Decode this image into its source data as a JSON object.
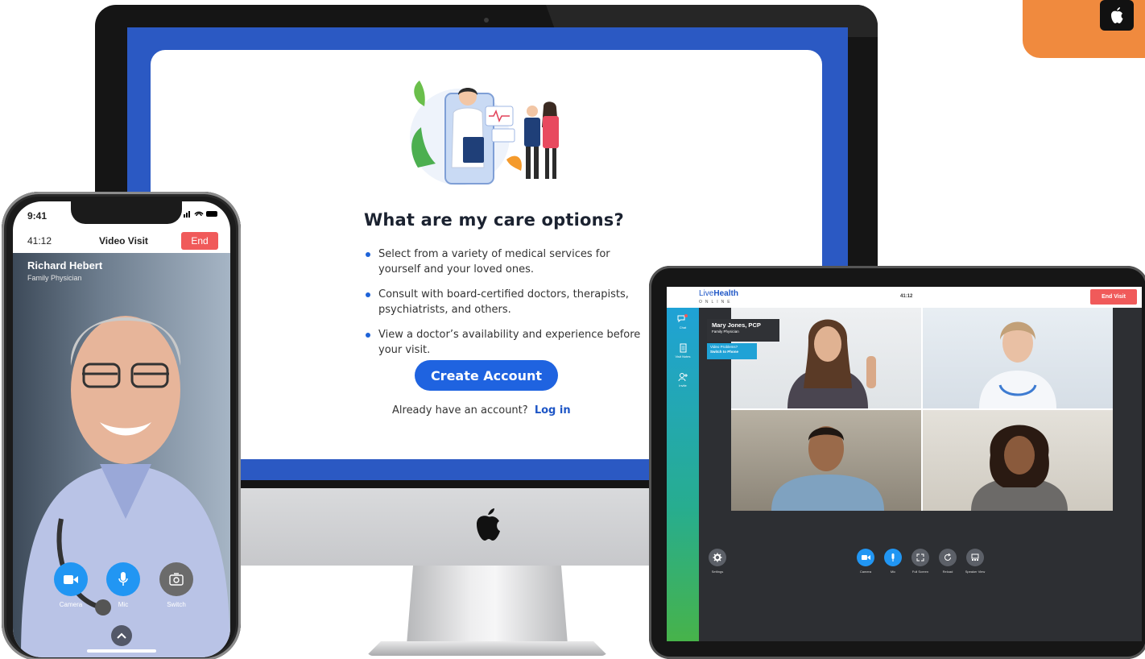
{
  "imac": {
    "title": "What are my care options?",
    "bullets": [
      "Select from a variety of medical services for yourself and your loved ones.",
      "Consult with board-certified doctors, therapists, psychiatrists, and others.",
      "View a doctor’s availability and experience before your visit."
    ],
    "create_account": "Create Account",
    "login_prompt": "Already have an account?",
    "login_link": "Log in"
  },
  "phone": {
    "status_time": "9:41",
    "call_timer": "41:12",
    "call_title": "Video Visit",
    "end_label": "End",
    "doctor_name": "Richard Hebert",
    "doctor_role": "Family Physician",
    "controls": [
      {
        "label": "Camera",
        "icon": "video-camera-icon",
        "color": "#2196f3"
      },
      {
        "label": "Mic",
        "icon": "microphone-icon",
        "color": "#2196f3"
      },
      {
        "label": "Switch",
        "icon": "camera-switch-icon",
        "color": "#6b6b6b"
      }
    ]
  },
  "tablet": {
    "logo_main": "Live",
    "logo_bold": "Health",
    "logo_sub": "ONLINE",
    "timer": "41:12",
    "end_label": "End Visit",
    "sidebar": [
      {
        "label": "Chat",
        "icon": "chat-icon"
      },
      {
        "label": "Visit Notes",
        "icon": "notes-icon"
      },
      {
        "label": "Invite",
        "icon": "add-person-icon"
      }
    ],
    "card_name": "Mary Jones, PCP",
    "card_role": "Family Physician",
    "video_problems": "Video Problems?",
    "switch_phone": "Switch to Phone",
    "settings_label": "Settings",
    "controls": [
      {
        "label": "Camera",
        "icon": "video-camera-icon",
        "color": "#2196f3"
      },
      {
        "label": "Mic",
        "icon": "microphone-icon",
        "color": "#2196f3"
      },
      {
        "label": "Full Screen",
        "icon": "fullscreen-icon",
        "color": "#5c6068"
      },
      {
        "label": "Reload",
        "icon": "reload-icon",
        "color": "#5c6068"
      },
      {
        "label": "Speaker View",
        "icon": "speaker-view-icon",
        "color": "#5c6068"
      }
    ]
  },
  "colors": {
    "brand_blue": "#1f63e0",
    "screen_blue": "#2b59c3",
    "end_red": "#f05a5a",
    "badge_orange": "#f08a3e"
  }
}
